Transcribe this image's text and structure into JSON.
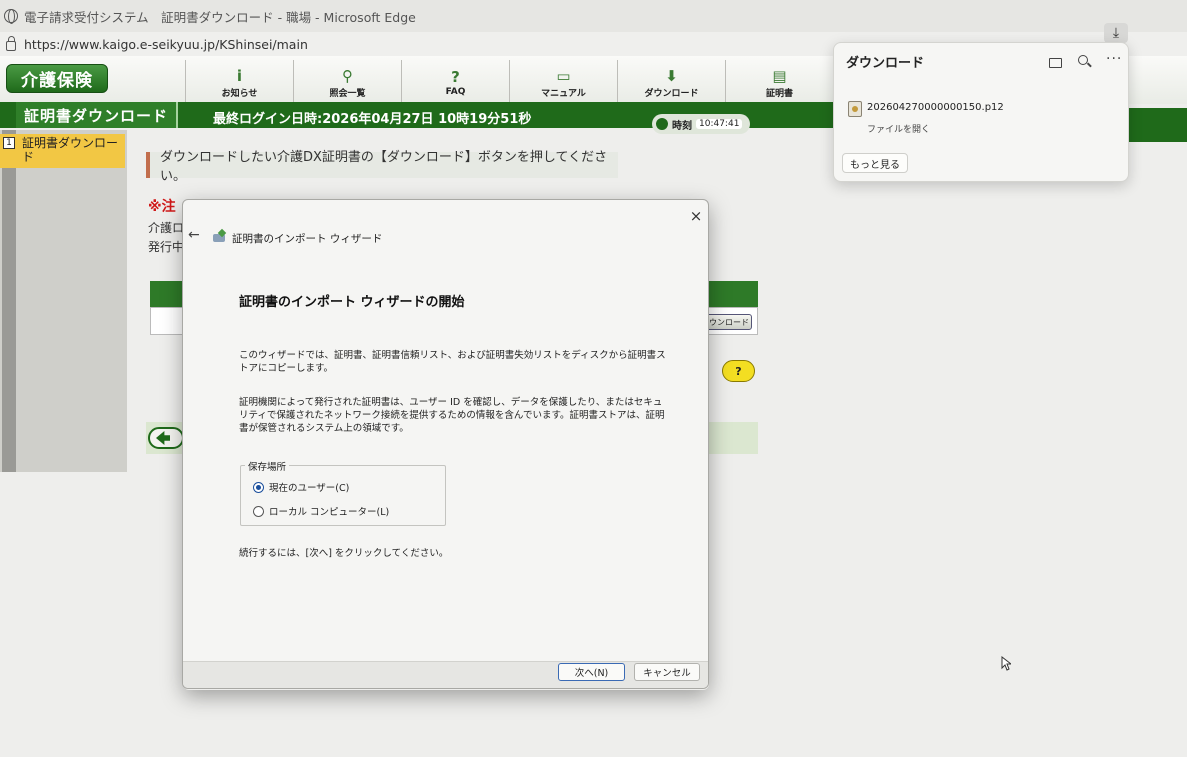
{
  "browser": {
    "window_title": "電子請求受付システム　証明書ダウンロード - 職場 - Microsoft Edge",
    "url": "https://www.kaigo.e-seikyuu.jp/KShinsei/main"
  },
  "site": {
    "logo": "介護保険",
    "nav": [
      {
        "label": "お知らせ",
        "icon": "info-icon",
        "glyph": "i"
      },
      {
        "label": "照会一覧",
        "icon": "search-icon",
        "glyph": "⚲"
      },
      {
        "label": "FAQ",
        "icon": "faq-icon",
        "glyph": "?"
      },
      {
        "label": "マニュアル",
        "icon": "book-icon",
        "glyph": "▭"
      },
      {
        "label": "ダウンロード",
        "icon": "download-icon",
        "glyph": "⬇"
      },
      {
        "label": "証明書",
        "icon": "certificate-icon",
        "glyph": "▤"
      }
    ],
    "page_title": "証明書ダウンロード",
    "last_login": "最終ログイン日時:2026年04月27日 10時19分51秒",
    "clock_label": "時刻",
    "clock_time": "10:47:41",
    "sidebar": {
      "number": "1",
      "label": "証明書ダウンロード"
    },
    "instruction": "ダウンロードしたい介護DX証明書の【ダウンロード】ボタンを押してください。",
    "notice_red": "※注",
    "notice_line1": "介護ロ",
    "notice_line2": "発行中",
    "table_download_btn": "ウンロード",
    "help_btn": "?"
  },
  "downloads": {
    "title": "ダウンロード",
    "file_name": "202604270000000150.p12",
    "open_file": "ファイルを開く",
    "see_more": "もっと見る",
    "more_glyph": "···"
  },
  "dialog": {
    "wizard_title": "証明書のインポート ウィザード",
    "heading": "証明書のインポート ウィザードの開始",
    "para1": "このウィザードでは、証明書、証明書信頼リスト、および証明書失効リストをディスクから証明書ストアにコピーします。",
    "para2": "証明機関によって発行された証明書は、ユーザー ID を確認し、データを保護したり、またはセキュリティで保護されたネットワーク接続を提供するための情報を含んでいます。証明書ストアは、証明書が保管されるシステム上の領域です。",
    "store_legend": "保存場所",
    "option_current_user": "現在のユーザー(C)",
    "option_local_machine": "ローカル コンピューター(L)",
    "selected": "current_user",
    "continue_text": "続行するには、[次へ] をクリックしてください。",
    "next_btn": "次へ(N)",
    "cancel_btn": "キャンセル",
    "close_glyph": "×",
    "back_glyph": "←"
  }
}
